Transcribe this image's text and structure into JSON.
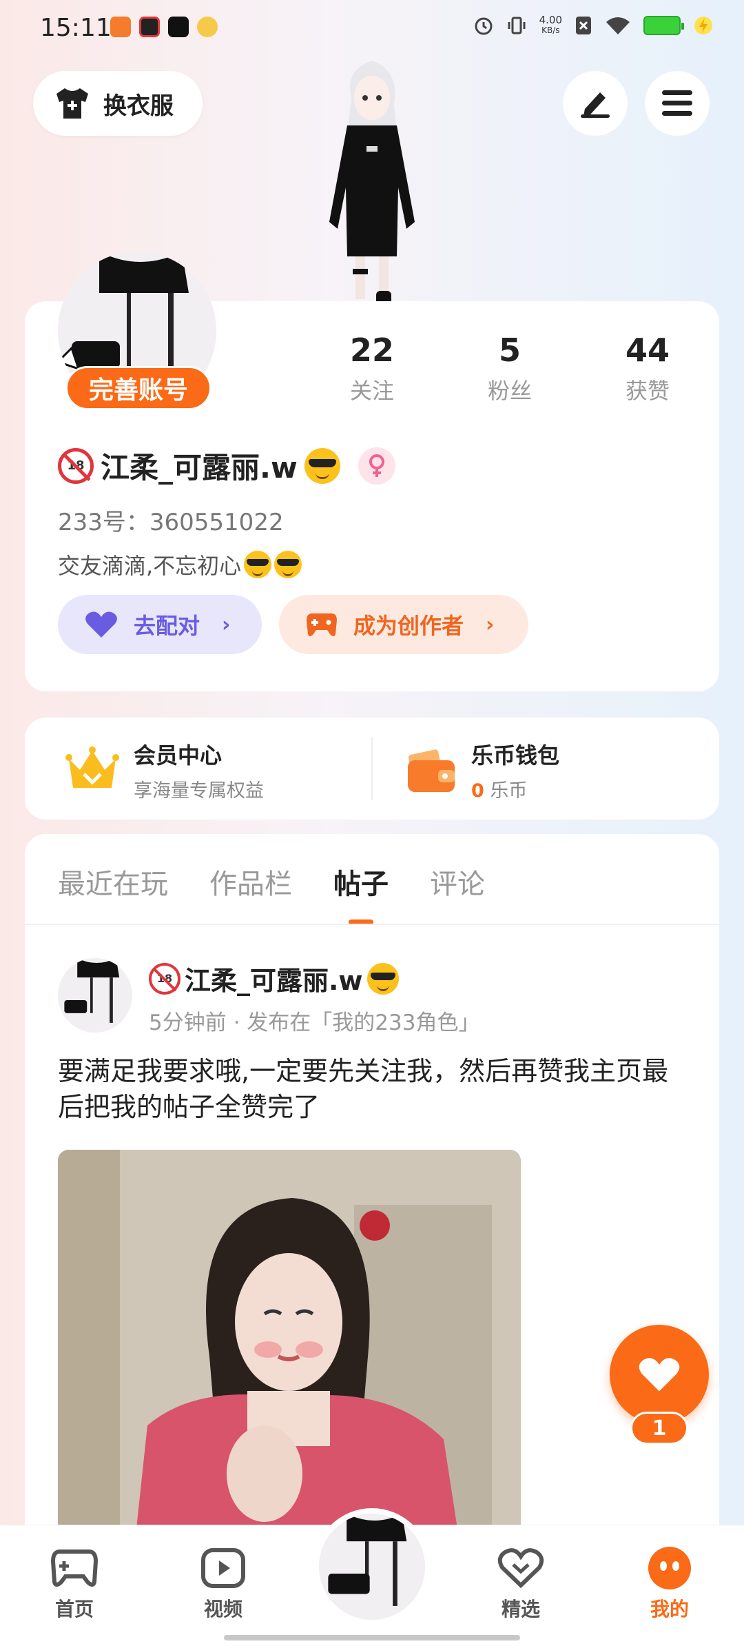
{
  "status_bar": {
    "time": "15:11",
    "speed_value": "4.00",
    "speed_unit": "KB/s"
  },
  "top": {
    "outfit_label": "换衣服"
  },
  "profile": {
    "badge": "完善账号",
    "stats": [
      {
        "num": "22",
        "label": "关注"
      },
      {
        "num": "5",
        "label": "粉丝"
      },
      {
        "num": "44",
        "label": "获赞"
      }
    ],
    "name": "江柔_可露丽.w",
    "uid": "233号：360551022",
    "bio": "交友滴滴,不忘初心",
    "match_label": "去配对",
    "creator_label": "成为创作者"
  },
  "member": {
    "title": "会员中心",
    "sub": "享海量专属权益"
  },
  "wallet": {
    "title": "乐币钱包",
    "amount": "0",
    "unit": "乐币"
  },
  "tabs": [
    {
      "label": "最近在玩"
    },
    {
      "label": "作品栏"
    },
    {
      "label": "帖子"
    },
    {
      "label": "评论"
    }
  ],
  "post": {
    "author": "江柔_可露丽.w",
    "meta": "5分钟前 · 发布在「我的233角色」",
    "text": "要满足我要求哦,一定要先关注我，然后再赞我主页最后把我的帖子全赞完了"
  },
  "like": {
    "count": "1"
  },
  "nav": {
    "items": [
      {
        "label": "首页"
      },
      {
        "label": "视频"
      },
      {
        "label": "精选"
      },
      {
        "label": "我的"
      }
    ]
  },
  "colors": {
    "accent": "#fa6a17",
    "match": "#6a5ce0",
    "creator": "#f0651f"
  }
}
